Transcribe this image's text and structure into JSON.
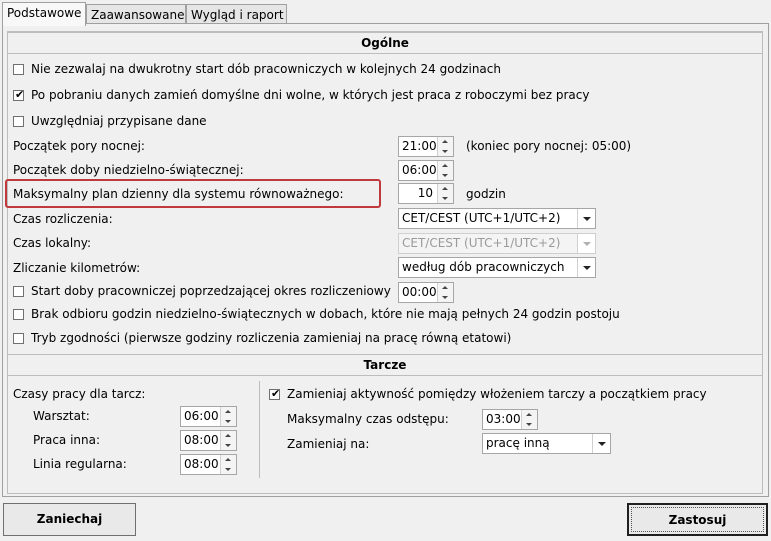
{
  "tabs": [
    {
      "label": "Podstawowe",
      "active": true
    },
    {
      "label": "Zaawansowane",
      "active": false
    },
    {
      "label": "Wygląd i raport",
      "active": false
    }
  ],
  "general": {
    "header": "Ogólne",
    "no_double_start": {
      "label": "Nie zezwalaj na dwukrotny start dób pracowniczych w kolejnych 24 godzinach",
      "checked": false
    },
    "replace_days_off": {
      "label": "Po pobraniu danych zamień domyślne dni wolne, w których jest praca z roboczymi bez pracy",
      "checked": true
    },
    "include_assigned": {
      "label": "Uwzględniaj przypisane dane",
      "checked": false
    },
    "night_start": {
      "label": "Początek pory nocnej:",
      "value": "21:00",
      "note": "(koniec pory nocnej: 05:00)"
    },
    "holiday_day_start": {
      "label": "Początek doby niedzielno-świątecznej:",
      "value": "06:00"
    },
    "max_plan": {
      "label": "Maksymalny plan dzienny dla systemu równoważnego:",
      "value": "10",
      "unit": "godzin"
    },
    "settlement_time": {
      "label": "Czas rozliczenia:",
      "value": "CET/CEST (UTC+1/UTC+2)"
    },
    "local_time": {
      "label": "Czas lokalny:",
      "value": "CET/CEST (UTC+1/UTC+2)"
    },
    "km_counting": {
      "label": "Zliczanie kilometrów:",
      "value": "według dób pracowniczych"
    },
    "workday_start_prev": {
      "label": "Start doby pracowniczej poprzedzającej okres rozliczeniowy",
      "value": "00:00",
      "checked": false
    },
    "no_holiday_hours": {
      "label": "Brak odbioru godzin niedzielno-świątecznych w dobach, które nie mają pełnych 24 godzin postoju",
      "checked": false
    },
    "compat_mode": {
      "label": "Tryb zgodności (pierwsze godziny rozliczenia zamieniaj na pracę równą etatowi)",
      "checked": false
    }
  },
  "discs": {
    "header": "Tarcze",
    "work_times_label": "Czasy pracy dla tarcz:",
    "workshop": {
      "label": "Warsztat:",
      "value": "06:00"
    },
    "other_work": {
      "label": "Praca inna:",
      "value": "08:00"
    },
    "regular_line": {
      "label": "Linia regularna:",
      "value": "08:00"
    },
    "replace_activity": {
      "label": "Zamieniaj aktywność pomiędzy włożeniem tarczy a początkiem pracy",
      "checked": true
    },
    "max_gap": {
      "label": "Maksymalny czas odstępu:",
      "value": "03:00"
    },
    "replace_with": {
      "label": "Zamieniaj na:",
      "value": "pracę inną"
    }
  },
  "buttons": {
    "cancel": "Zaniechaj",
    "apply": "Zastosuj"
  }
}
